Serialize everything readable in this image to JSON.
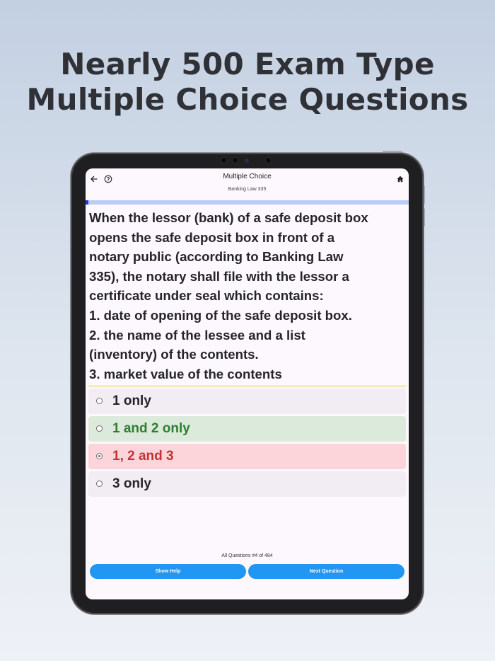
{
  "headline": {
    "line1": "Nearly 500 Exam Type",
    "line2": "Multiple Choice Questions"
  },
  "app": {
    "title": "Multiple Choice",
    "subtitle": "Banking Law 335",
    "icons": {
      "back": "arrow-left-icon",
      "help": "help-circle-icon",
      "home": "home-icon"
    },
    "progress_fraction": 0.0083,
    "question_lines": [
      "When the lessor (bank) of a safe deposit box",
      "opens the safe deposit box in front of a",
      "notary public (according to Banking Law",
      "335), the notary shall file with the lessor a",
      "certificate under seal which contains:",
      "1. date of opening of the safe deposit box.",
      "2. the name of the lessee and a list",
      "(inventory) of the contents.",
      "3. market value of the contents"
    ],
    "options": [
      {
        "label": "1 only",
        "state": "neutral",
        "selected": false
      },
      {
        "label": "1 and 2 only",
        "state": "correct",
        "selected": false
      },
      {
        "label": "1, 2 and 3",
        "state": "wrong",
        "selected": true
      },
      {
        "label": "3 only",
        "state": "neutral",
        "selected": false
      }
    ],
    "counter": "All Questions #4 of 484",
    "buttons": {
      "help": "Show Help",
      "next": "Next Question"
    }
  },
  "colors": {
    "neutral_bg": "#f1edf2",
    "neutral_text": "#252528",
    "correct_bg": "#dbeadb",
    "correct_text": "#2f7d32",
    "wrong_bg": "#fbd5da",
    "wrong_text": "#c62f33",
    "accent": "#2196f3",
    "progress": "#1f3ad6"
  }
}
